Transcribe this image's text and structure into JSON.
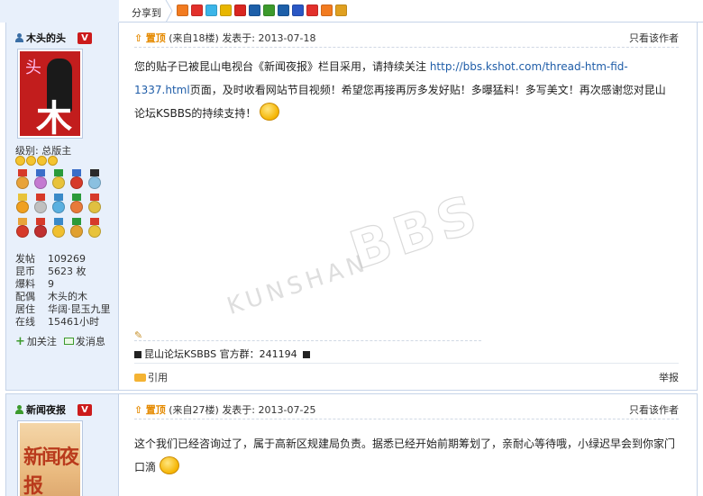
{
  "share": {
    "label": "分享到",
    "icons": [
      {
        "name": "qzone-icon",
        "color": "#f27b20"
      },
      {
        "name": "weibo-icon",
        "color": "#e2302b"
      },
      {
        "name": "qq-icon",
        "color": "#3bb5e8"
      },
      {
        "name": "douban-icon",
        "color": "#e8b600"
      },
      {
        "name": "kaixin-icon",
        "color": "#d92620"
      },
      {
        "name": "renren-icon",
        "color": "#1d5fa9"
      },
      {
        "name": "sohu-icon",
        "color": "#3c9a2c"
      },
      {
        "name": "netease-icon",
        "color": "#1d5fa9"
      },
      {
        "name": "baidu-icon",
        "color": "#2a57c4"
      },
      {
        "name": "taobao-icon",
        "color": "#e2302b"
      },
      {
        "name": "tianya-icon",
        "color": "#f27b20"
      },
      {
        "name": "more-icon",
        "color": "#e0a020"
      }
    ]
  },
  "post1": {
    "author": "木头的头",
    "vip": "V",
    "avatar_glyphs": {
      "top": "头",
      "bottom": "木"
    },
    "level_label": "级别: 总版主",
    "stats": [
      {
        "k": "发帖",
        "v": "109269"
      },
      {
        "k": "昆币",
        "v": "5623 枚"
      },
      {
        "k": "爆料",
        "v": "9"
      },
      {
        "k": "配偶",
        "v": "木头的木"
      },
      {
        "k": "居住",
        "v": "华阔·昆玉九里"
      },
      {
        "k": "在线",
        "v": "15461小时"
      }
    ],
    "follow_label": "加关注",
    "message_label": "发消息",
    "sticky": "置顶",
    "from_floor": "(来自18楼)",
    "posted": "发表于: 2013-07-18",
    "only_author": "只看该作者",
    "body_before_link": "您的贴子已被昆山电视台《新闻夜报》栏目采用，请持续关注 ",
    "link": "http://bbs.kshot.com/thread-htm-fid-1337.html",
    "body_after_link": "页面，及时收看网站节目视频！希望您再接再厉多发好贴！多曝猛料！多写美文！再次感谢您对昆山论坛KSBBS的持续支持！",
    "signature": "昆山论坛KSBBS 官方群：241194",
    "quote": "引用",
    "report": "举报"
  },
  "post2": {
    "author": "新闻夜报",
    "vip": "V",
    "avatar_text": "新闻夜报",
    "sticky": "置顶",
    "from_floor": "(来自27楼)",
    "posted": "发表于: 2013-07-25",
    "only_author": "只看该作者",
    "body": "这个我们已经咨询过了，属于高新区规建局负责。据悉已经开始前期筹划了，亲耐心等待哦，小绿迟早会到你家门口滴"
  }
}
